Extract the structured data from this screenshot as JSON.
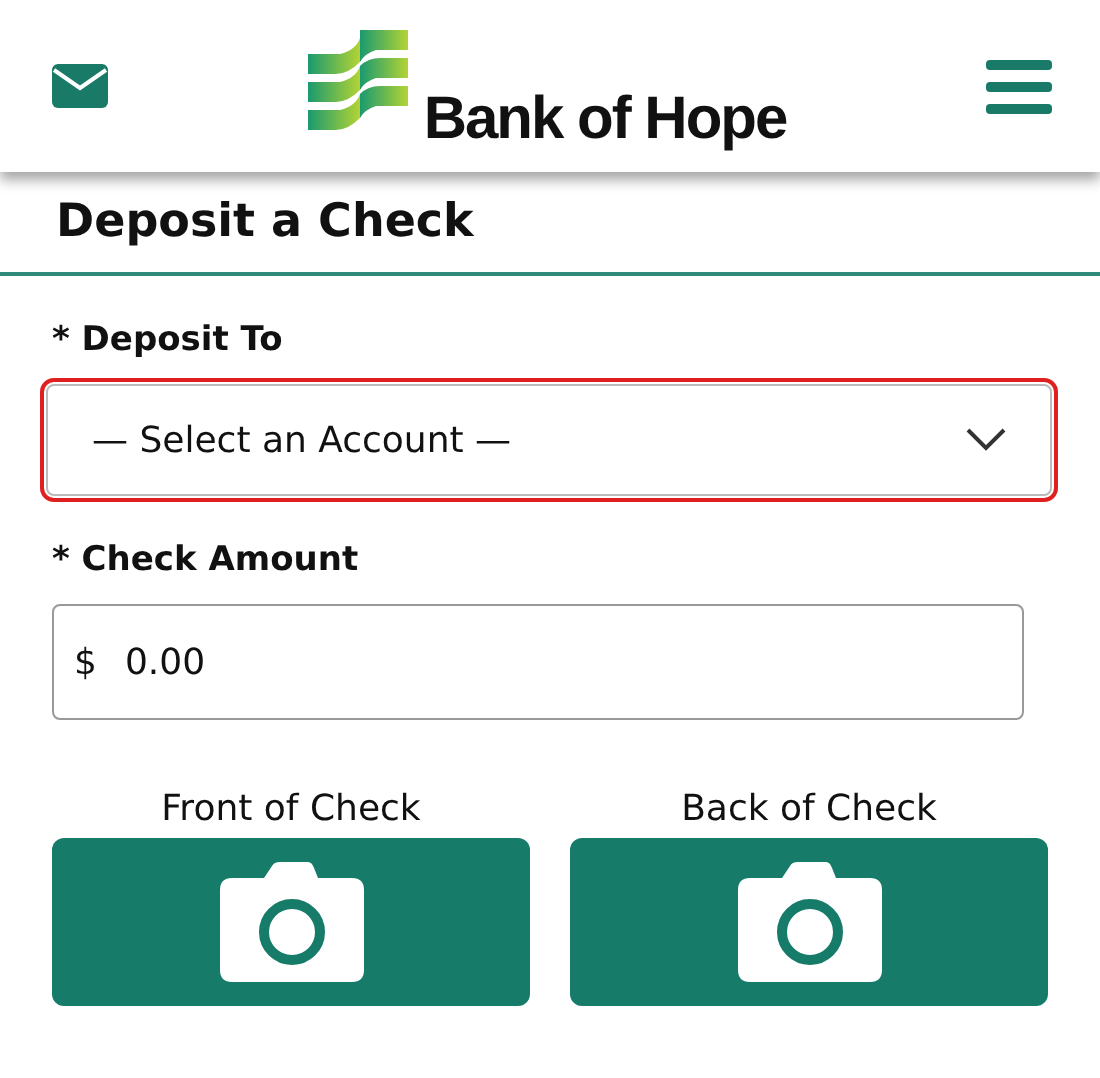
{
  "header": {
    "brand": "Bank of Hope"
  },
  "page_title": "Deposit a Check",
  "deposit_to": {
    "label": "* Deposit To",
    "value": "— Select an Account —",
    "highlighted": true
  },
  "check_amount": {
    "label": "* Check Amount",
    "prefix": "$",
    "value": "0.00"
  },
  "captures": [
    {
      "label": "Front of Check"
    },
    {
      "label": "Back of Check"
    }
  ]
}
